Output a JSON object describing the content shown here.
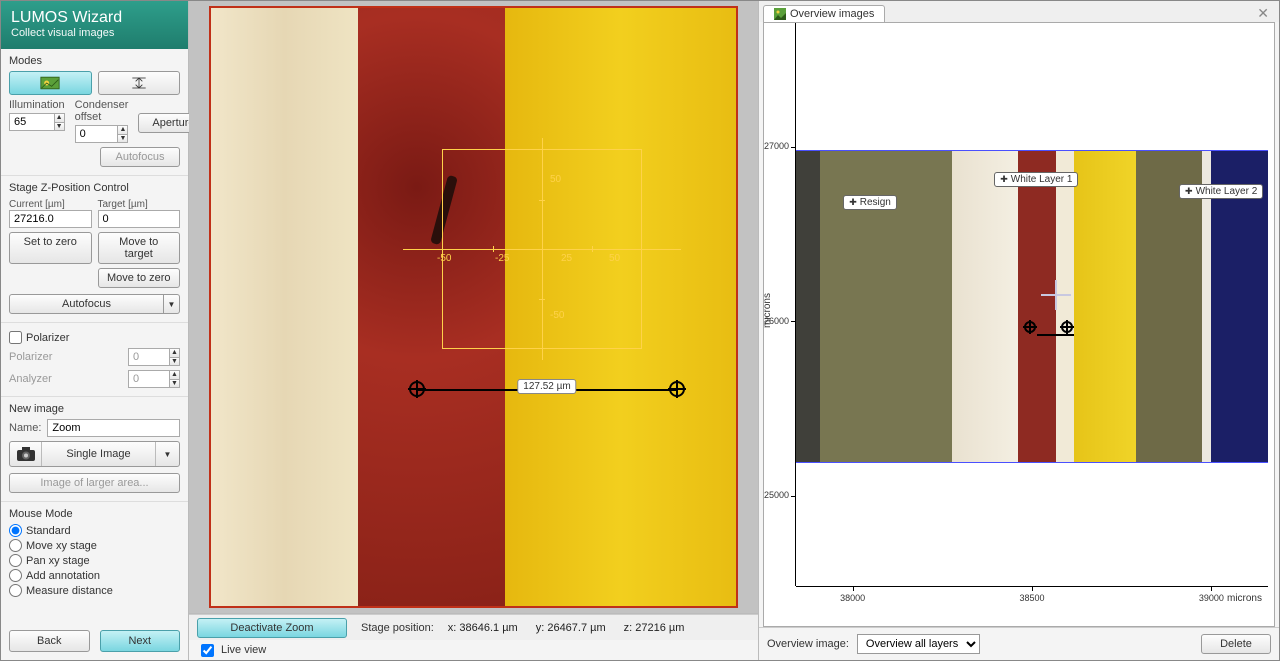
{
  "header": {
    "title": "LUMOS Wizard",
    "subtitle": "Collect visual images"
  },
  "sidebar": {
    "modes_label": "Modes",
    "illumination_label": "Illumination",
    "condenser_label": "Condenser offset",
    "illumination_value": "65",
    "condenser_value": "0",
    "aperture_btn": "Aperture",
    "autofocus_btn": "Autofocus",
    "stage": {
      "section_title": "Stage Z-Position Control",
      "current_label": "Current [µm]",
      "target_label": "Target [µm]",
      "current_value": "27216.0",
      "target_value": "0",
      "set_to_zero": "Set to zero",
      "move_to_target": "Move to target",
      "move_to_zero": "Move to zero",
      "autofocus": "Autofocus"
    },
    "polarizer": {
      "chk_label": "Polarizer",
      "polarizer_row": "Polarizer",
      "analyzer_row": "Analyzer",
      "pol_value": "0",
      "ana_value": "0"
    },
    "newimage": {
      "section": "New image",
      "name_label": "Name:",
      "name_value": "Zoom",
      "single_image": "Single Image",
      "larger_area": "Image of larger area..."
    },
    "mousemode": {
      "section": "Mouse Mode",
      "standard": "Standard",
      "move_xy": "Move xy stage",
      "pan_xy": "Pan xy stage",
      "add_ann": "Add annotation",
      "measure": "Measure distance"
    },
    "footer": {
      "back": "Back",
      "next": "Next"
    }
  },
  "center": {
    "roi": {
      "ticks_h": [
        "-50",
        "-25",
        "25",
        "50"
      ],
      "ticks_v": [
        "50",
        "-50"
      ]
    },
    "measure_label": "127.52 µm",
    "footer": {
      "deactivate_zoom": "Deactivate Zoom",
      "stage_label": "Stage position:",
      "x": "x: 38646.1 µm",
      "y": "y: 26467.7 µm",
      "z": "z: 27216 µm"
    },
    "live_view": "Live view"
  },
  "right": {
    "tab_label": "Overview images",
    "y_axis_label": "microns",
    "x_axis_label": "microns",
    "y_ticks": [
      "27000",
      "26000",
      "25000"
    ],
    "x_ticks": [
      "38000",
      "38500",
      "39000"
    ],
    "annotations": {
      "resign": "Resign",
      "white1": "White Layer 1",
      "white2": "White Layer 2"
    },
    "footer": {
      "label": "Overview image:",
      "select": "Overview all layers",
      "delete": "Delete"
    }
  }
}
